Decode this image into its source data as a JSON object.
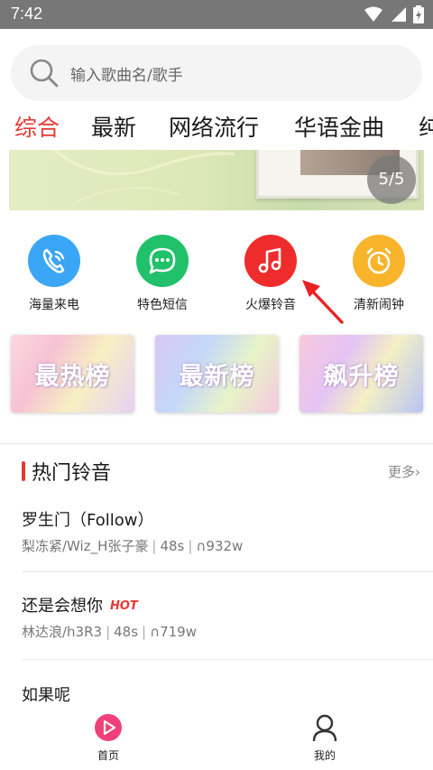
{
  "status_bar": {
    "time": "7:42"
  },
  "search": {
    "placeholder": "输入歌曲名/歌手"
  },
  "tabs": [
    {
      "label": "综合",
      "active": true
    },
    {
      "label": "最新",
      "active": false
    },
    {
      "label": "网络流行",
      "active": false
    },
    {
      "label": "华语金曲",
      "active": false
    },
    {
      "label": "纯",
      "active": false
    }
  ],
  "banner": {
    "indicator": "5/5"
  },
  "features": [
    {
      "label": "海量来电",
      "icon": "phone-icon",
      "color": "#3aa6f5"
    },
    {
      "label": "特色短信",
      "icon": "message-icon",
      "color": "#21c16b"
    },
    {
      "label": "火爆铃音",
      "icon": "music-note-icon",
      "color": "#ef2c2c"
    },
    {
      "label": "清新闹钟",
      "icon": "alarm-clock-icon",
      "color": "#f8b52b"
    }
  ],
  "charts": [
    {
      "label": "最热榜"
    },
    {
      "label": "最新榜"
    },
    {
      "label": "飙升榜"
    }
  ],
  "hot_section": {
    "title": "热门铃音",
    "more": "更多"
  },
  "songs": [
    {
      "name": "罗生门（Follow）",
      "artist": "梨冻紧/Wiz_H张子豪",
      "duration": "48s",
      "plays": "932w",
      "hot": ""
    },
    {
      "name": "还是会想你",
      "artist": "林达浪/h3R3",
      "duration": "48s",
      "plays": "719w",
      "hot": "HOT"
    },
    {
      "name": "如果呢",
      "artist": "",
      "duration": "",
      "plays": "",
      "hot": ""
    }
  ],
  "bottom_nav": [
    {
      "label": "首页",
      "active": true
    },
    {
      "label": "我的",
      "active": false
    }
  ],
  "colors": {
    "accent": "#e53935",
    "home_icon": "#f0407a"
  }
}
